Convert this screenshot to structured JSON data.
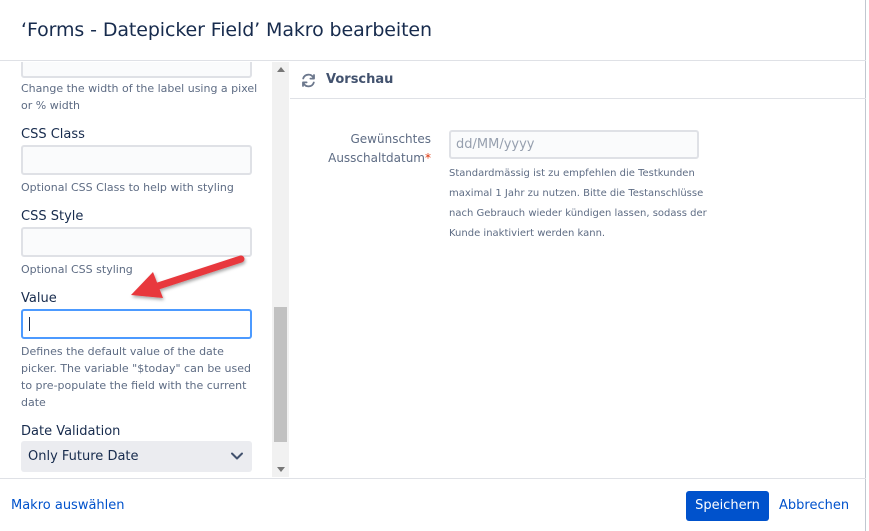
{
  "dialog": {
    "title": "‘Forms - Datepicker Field’ Makro bearbeiten"
  },
  "left_panel": {
    "width_field": {
      "description": "Change the width of the label using a pixel or % width"
    },
    "css_class": {
      "label": "CSS Class",
      "value": "",
      "description": "Optional CSS Class to help with styling"
    },
    "css_style": {
      "label": "CSS Style",
      "value": "",
      "description": "Optional CSS styling"
    },
    "value_field": {
      "label": "Value",
      "value": "",
      "description": "Defines the default value of the date picker. The variable \"$today\" can be used to pre-populate the field with the current date"
    },
    "date_validation": {
      "label": "Date Validation",
      "selected": "Only Future Date"
    }
  },
  "preview": {
    "title": "Vorschau",
    "field_label": "Gewünschtes Ausschaltdatum",
    "required_marker": "*",
    "input_placeholder": "dd/MM/yyyy",
    "help_text": "Standardmässig ist zu empfehlen die Testkunden maximal 1 Jahr zu nutzen. Bitte die Testanschlüsse nach Gebrauch wieder kündigen lassen, sodass der Kunde inaktiviert werden kann."
  },
  "footer": {
    "select_macro_label": "Makro auswählen",
    "save_label": "Speichern",
    "cancel_label": "Abbrechen"
  },
  "colors": {
    "primary": "#0052cc",
    "focus_border": "#4c9aff",
    "annotation_arrow": "#e8383d",
    "required": "#de350b"
  },
  "icons": {
    "preview_refresh": "refresh-icon",
    "select_chevron": "chevron-down-icon",
    "annotation": "red-arrow-annotation"
  }
}
